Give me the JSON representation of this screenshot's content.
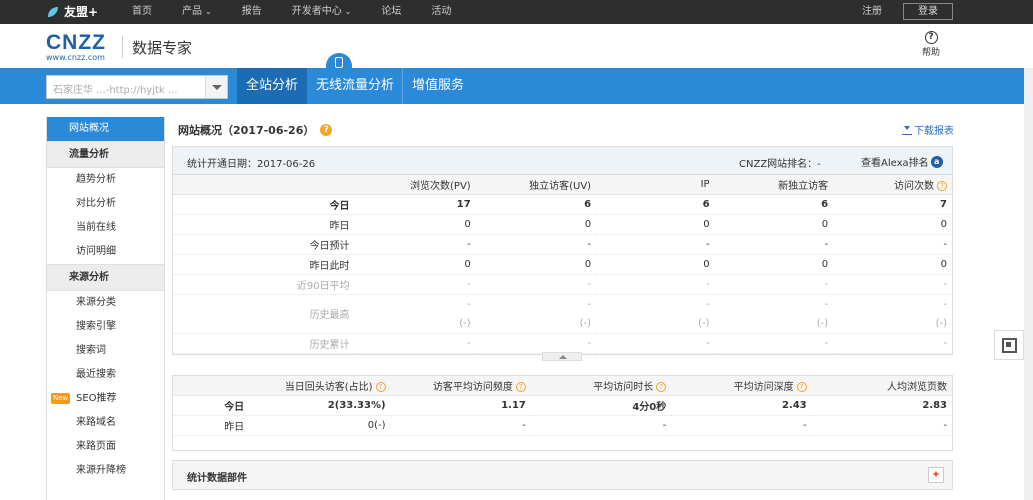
{
  "topbar": {
    "brand": "友盟+",
    "nav": [
      {
        "label": "首页",
        "caret": false
      },
      {
        "label": "产品",
        "caret": true
      },
      {
        "label": "报告",
        "caret": false
      },
      {
        "label": "开发者中心",
        "caret": true
      },
      {
        "label": "论坛",
        "caret": false
      },
      {
        "label": "活动",
        "caret": false
      }
    ],
    "register": "注册",
    "login": "登录"
  },
  "header": {
    "logo_text": "CNZZ",
    "logo_url": "www.cnzz.com",
    "title": "数据专家",
    "help": "帮助"
  },
  "bluenav": {
    "site_selector_value": "石家庄华 ...-http://hyjtk ...",
    "tabs": [
      "全站分析",
      "无线流量分析",
      "增值服务"
    ],
    "active_tab": 0
  },
  "sidebar": {
    "items": [
      {
        "label": "网站概况",
        "kind": "active"
      },
      {
        "label": "流量分析",
        "kind": "group"
      },
      {
        "label": "趋势分析",
        "kind": "item"
      },
      {
        "label": "对比分析",
        "kind": "item"
      },
      {
        "label": "当前在线",
        "kind": "item"
      },
      {
        "label": "访问明细",
        "kind": "item"
      },
      {
        "label": "来源分析",
        "kind": "group"
      },
      {
        "label": "来源分类",
        "kind": "item"
      },
      {
        "label": "搜索引擎",
        "kind": "item"
      },
      {
        "label": "搜索词",
        "kind": "item"
      },
      {
        "label": "最近搜索",
        "kind": "item"
      },
      {
        "label": "SEO推荐",
        "kind": "item",
        "badge": "New"
      },
      {
        "label": "来路域名",
        "kind": "item"
      },
      {
        "label": "来路页面",
        "kind": "item"
      },
      {
        "label": "来源升降榜",
        "kind": "item"
      }
    ]
  },
  "main": {
    "title": "网站概况（2017-06-26）",
    "download": "下载报表",
    "info": {
      "start_date": "统计开通日期：2017-06-26",
      "cnzz_rank": "CNZZ网站排名：-",
      "alexa": "查看Alexa排名"
    },
    "table1": {
      "headers": [
        "",
        "浏览次数(PV)",
        "独立访客(UV)",
        "IP",
        "新独立访客",
        "访问次数"
      ],
      "rows": [
        {
          "label": "今日",
          "values": [
            "17",
            "6",
            "6",
            "6",
            "7"
          ],
          "style": "bold"
        },
        {
          "label": "昨日",
          "values": [
            "0",
            "0",
            "0",
            "0",
            "0"
          ],
          "style": ""
        },
        {
          "label": "今日预计",
          "values": [
            "-",
            "-",
            "-",
            "-",
            "-"
          ],
          "style": ""
        },
        {
          "label": "昨日此时",
          "values": [
            "0",
            "0",
            "0",
            "0",
            "0"
          ],
          "style": ""
        },
        {
          "label": "近90日平均",
          "values": [
            "-",
            "-",
            "-",
            "-",
            "-"
          ],
          "style": "muted"
        },
        {
          "label": "历史最高",
          "values": [
            "-|(-)",
            "-|(-)",
            "-|(-)",
            "-|(-)",
            "-|(-)"
          ],
          "style": "muted tall"
        },
        {
          "label": "历史累计",
          "values": [
            "-",
            "-",
            "-",
            "-",
            "-"
          ],
          "style": "muted"
        }
      ]
    },
    "table2": {
      "headers": [
        "",
        "当日回头访客(占比)",
        "访客平均访问频度",
        "平均访问时长",
        "平均访问深度",
        "人均浏览页数"
      ],
      "rows": [
        {
          "label": "今日",
          "values": [
            "2(33.33%)",
            "1.17",
            "4分0秒",
            "2.43",
            "2.83"
          ],
          "style": "bold"
        },
        {
          "label": "昨日",
          "values": [
            "0(-)",
            "-",
            "-",
            "-",
            "-"
          ],
          "style": ""
        }
      ]
    },
    "widget_title": "统计数据部件"
  }
}
